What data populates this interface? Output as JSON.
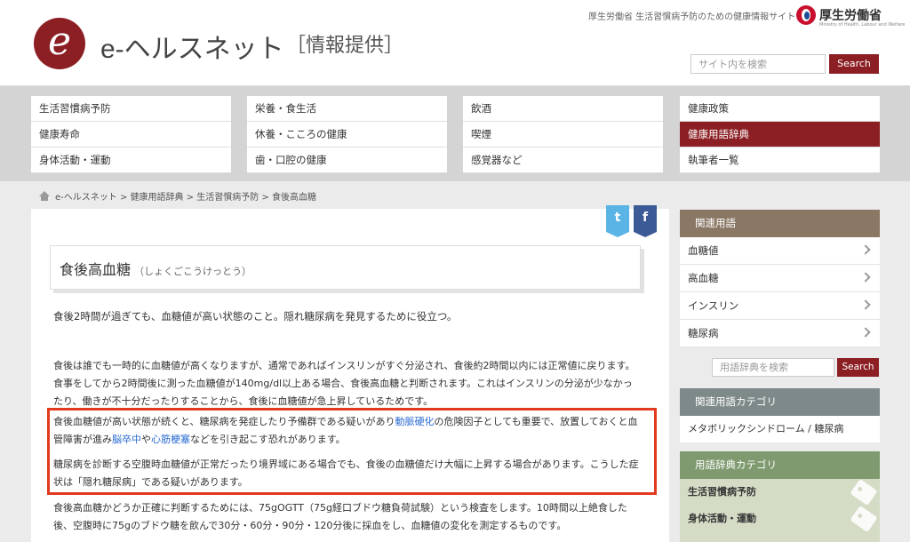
{
  "header": {
    "logo_letter": "e",
    "site_name": "e-ヘルスネット",
    "site_sub": "［情報提供］",
    "tagline": "厚生労働省 生活習慣病予防のための健康情報サイト",
    "ministry_name": "厚生労働省",
    "ministry_en": "Ministry of Health, Labour and Welfare",
    "search_placeholder": "サイト内を検索",
    "search_button": "Search"
  },
  "nav": {
    "columns": [
      [
        "生活習慣病予防",
        "健康寿命",
        "身体活動・運動"
      ],
      [
        "栄養・食生活",
        "休養・こころの健康",
        "歯・口腔の健康"
      ],
      [
        "飲酒",
        "喫煙",
        "感覚器など"
      ],
      [
        "健康政策",
        "健康用語辞典",
        "執筆者一覧"
      ]
    ],
    "active": "健康用語辞典"
  },
  "breadcrumb": "e-ヘルスネット > 健康用語辞典 > 生活習慣病予防 > 食後高血糖",
  "social": {
    "twitter": "t",
    "facebook": "f"
  },
  "article": {
    "title": "食後高血糖",
    "reading": "（しょくごこうけっとう）",
    "lead": "食後2時間が過ぎても、血糖値が高い状態のこと。隠れ糖尿病を発見するために役立つ。",
    "p1": "食後は誰でも一時的に血糖値が高くなりますが、通常であればインスリンがすぐ分泌され、食後約2時間以内には正常値に戻ります。食事をしてから2時間後に測った血糖値が140mg/dl以上ある場合、食後高血糖と判断されます。これはインスリンの分泌が少なかったり、働きが不十分だったりすることから、食後に血糖値が急上昇しているためです。",
    "p2_a": "食後血糖値が高い状態が続くと、糖尿病を発症したり予備群である疑いがあり",
    "p2_link1": "動脈硬化",
    "p2_b": "の危険因子としても重要で、放置しておくと血管障害が進み",
    "p2_link2": "脳卒中",
    "p2_c": "や",
    "p2_link3": "心筋梗塞",
    "p2_d": "などを引き起こす恐れがあります。",
    "p3": "糖尿病を診断する空腹時血糖値が正常だったり境界域にある場合でも、食後の血糖値だけ大幅に上昇する場合があります。こうした症状は「隠れ糖尿病」である疑いがあります。",
    "p4": "食後高血糖かどうか正確に判断するためには、75gOGTT（75g経口ブドウ糖負荷試験）という検査をします。10時間以上絶食した後、空腹時に75gのブドウ糖を飲んで30分・60分・90分・120分後に採血をし、血糖値の変化を測定するものです。"
  },
  "sidebar": {
    "related_head": "関連用語",
    "related": [
      "血糖値",
      "高血糖",
      "インスリン",
      "糖尿病"
    ],
    "dict_placeholder": "用語辞典を検索",
    "dict_button": "Search",
    "cat_head": "関連用語カテゴリ",
    "cat_item": "メタボリックシンドローム / 糖尿病",
    "dcat_head": "用語辞典カテゴリ",
    "dcats": [
      "生活習慣病予防",
      "身体活動・運動"
    ]
  },
  "colors": {
    "brand": "#8b1f24",
    "link": "#2a6bd1",
    "highlight": "#e23a1e"
  }
}
